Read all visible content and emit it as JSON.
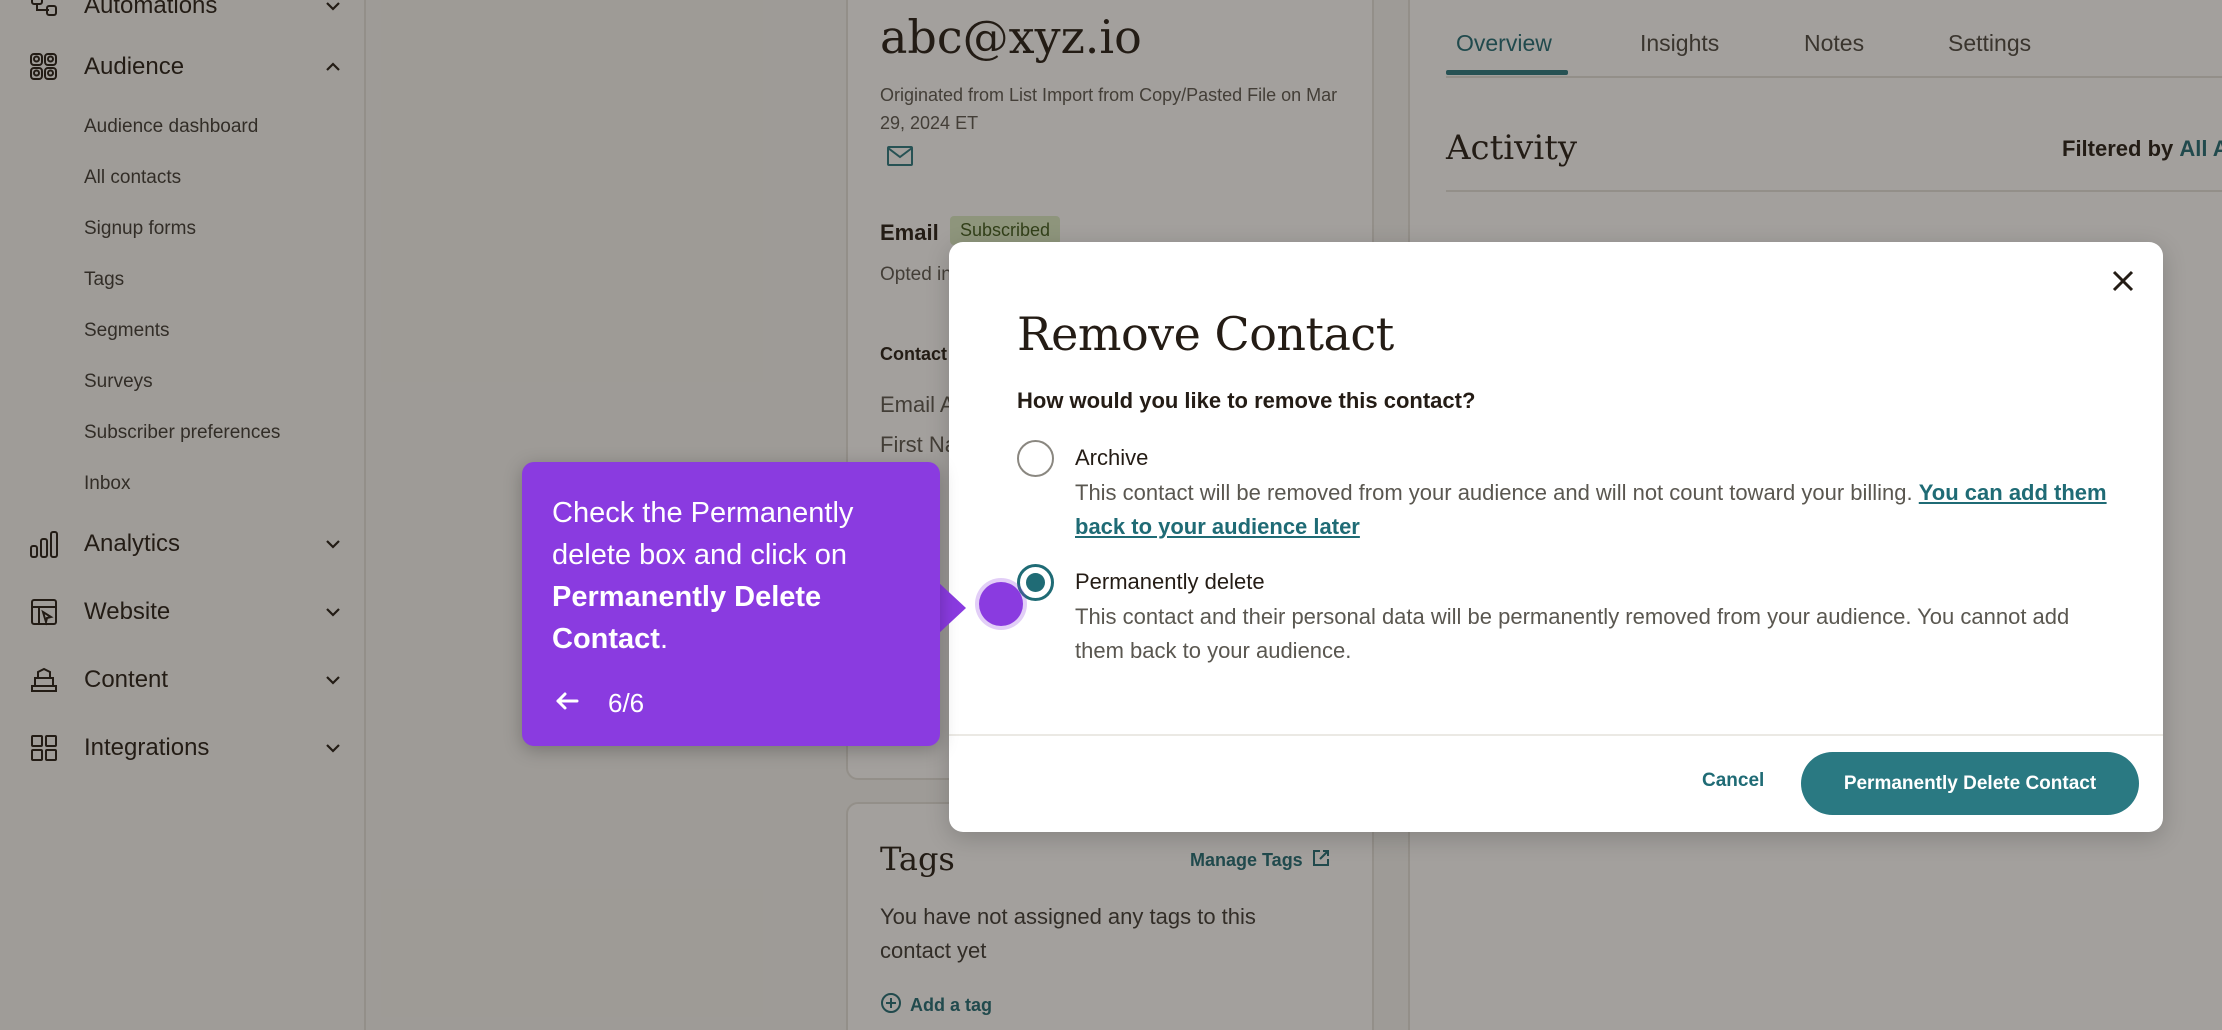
{
  "sidebar": {
    "automations_label": "Automations",
    "audience_label": "Audience",
    "audience_sub": [
      "Audience dashboard",
      "All contacts",
      "Signup forms",
      "Tags",
      "Segments",
      "Surveys",
      "Subscriber preferences",
      "Inbox"
    ],
    "analytics_label": "Analytics",
    "website_label": "Website",
    "content_label": "Content",
    "integrations_label": "Integrations"
  },
  "contact": {
    "email_address": "abc@xyz.io",
    "origin": "Originated from List Import from Copy/Pasted File on Mar 29, 2024 ET",
    "email_label": "Email",
    "status_badge": "Subscribed",
    "opted_in_partial": "Opted in",
    "contact_section_partial": "Contact",
    "field_email_partial": "Email A",
    "field_first_partial": "First Na"
  },
  "tags": {
    "title": "Tags",
    "manage_label": "Manage Tags",
    "empty_text": "You have not assigned any tags to this contact yet",
    "add_label": "Add a tag"
  },
  "right": {
    "tabs": [
      "Overview",
      "Insights",
      "Notes",
      "Settings"
    ],
    "active_tab": "Overview",
    "activity_title": "Activity",
    "filtered_by": "Filtered by",
    "filter_value_partial": "All A"
  },
  "modal": {
    "title": "Remove Contact",
    "question": "How would you like to remove this contact?",
    "options": [
      {
        "label": "Archive",
        "desc": "This contact will be removed from your audience and will not count toward your billing.",
        "link_text": "You can add them back to your audience later",
        "checked": false
      },
      {
        "label": "Permanently delete",
        "desc": "This contact and their personal data will be permanently removed from your audience. You cannot add them back to your audience.",
        "checked": true
      }
    ],
    "cancel_label": "Cancel",
    "confirm_label": "Permanently Delete Contact"
  },
  "tooltip": {
    "text_plain": "Check the Permanently delete box and click on",
    "text_bold": "Permanently Delete Contact",
    "text_end": ".",
    "step": "6/6"
  },
  "colors": {
    "accent_teal": "#2a7982",
    "tooltip_purple": "#8a3be0",
    "badge_green": "#dbecc6"
  }
}
